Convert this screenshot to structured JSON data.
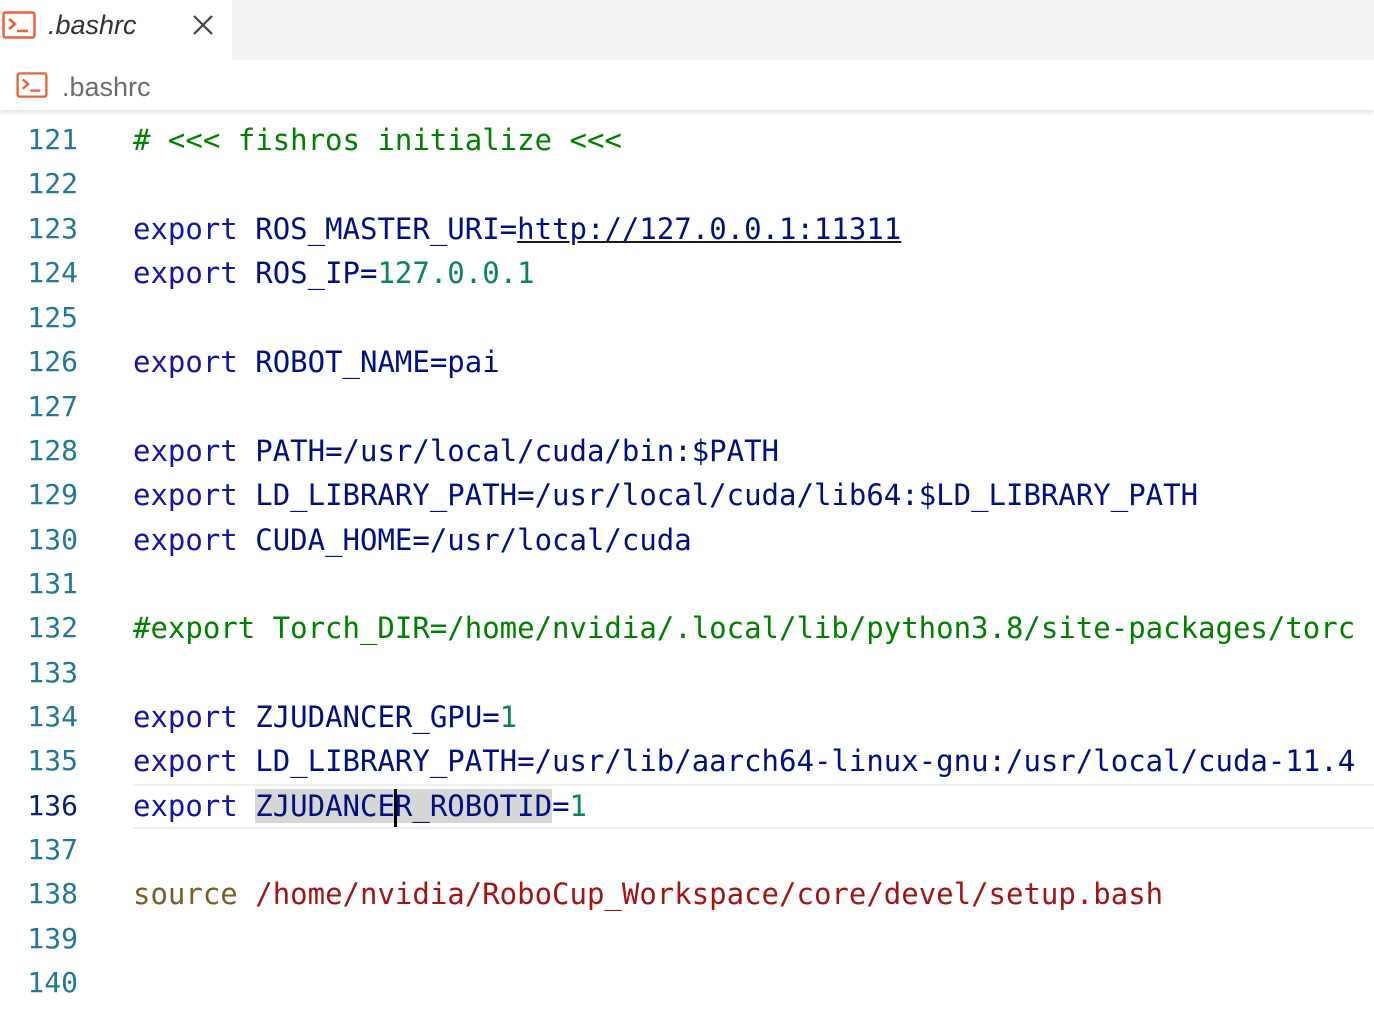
{
  "tab": {
    "title": ".bashrc",
    "icon": "terminal-icon",
    "close_icon": "close-icon"
  },
  "breadcrumb": {
    "icon": "terminal-icon",
    "label": ".bashrc"
  },
  "colors": {
    "keyword": "#1515a3",
    "variable": "#001080",
    "number": "#098658",
    "comment": "#008000",
    "source_keyword": "#795e26",
    "string": "#a31515",
    "line_number": "#237893",
    "active_line_number": "#0b216f",
    "icon_accent": "#e8633a"
  },
  "editor": {
    "lines": [
      {
        "number": "121",
        "text": "# <<< fishros initialize <<<"
      },
      {
        "number": "122",
        "text": ""
      },
      {
        "number": "123",
        "kw": "export",
        "var": "ROS_MASTER_URI=",
        "url": "http://127.0.0.1:11311"
      },
      {
        "number": "124",
        "kw": "export",
        "var": "ROS_IP=",
        "value": "127.0.0.1"
      },
      {
        "number": "125",
        "text": ""
      },
      {
        "number": "126",
        "kw": "export",
        "var": "ROBOT_NAME=pai"
      },
      {
        "number": "127",
        "text": ""
      },
      {
        "number": "128",
        "kw": "export",
        "var": "PATH=/usr/local/cuda/bin:$PATH"
      },
      {
        "number": "129",
        "kw": "export",
        "var": "LD_LIBRARY_PATH=/usr/local/cuda/lib64:$LD_LIBRARY_PATH"
      },
      {
        "number": "130",
        "kw": "export",
        "var": "CUDA_HOME=/usr/local/cuda"
      },
      {
        "number": "131",
        "text": ""
      },
      {
        "number": "132",
        "text": "#export Torch_DIR=/home/nvidia/.local/lib/python3.8/site-packages/torc"
      },
      {
        "number": "133",
        "text": ""
      },
      {
        "number": "134",
        "kw": "export",
        "var": "ZJUDANCER_GPU=",
        "value": "1"
      },
      {
        "number": "135",
        "kw": "export",
        "var": "LD_LIBRARY_PATH=/usr/lib/aarch64-linux-gnu:/usr/local/cuda-11.4"
      },
      {
        "number": "136",
        "kw": "export",
        "sel_before_cursor": "ZJUDANCE",
        "sel_after_cursor": "R_ROBOTID",
        "var_after": "=",
        "value": "1"
      },
      {
        "number": "137",
        "text": ""
      },
      {
        "number": "138",
        "kw": "source",
        "path": "/home/nvidia/RoboCup_Workspace/core/devel/setup.bash"
      },
      {
        "number": "139",
        "text": ""
      },
      {
        "number": "140",
        "text": ""
      }
    ]
  }
}
